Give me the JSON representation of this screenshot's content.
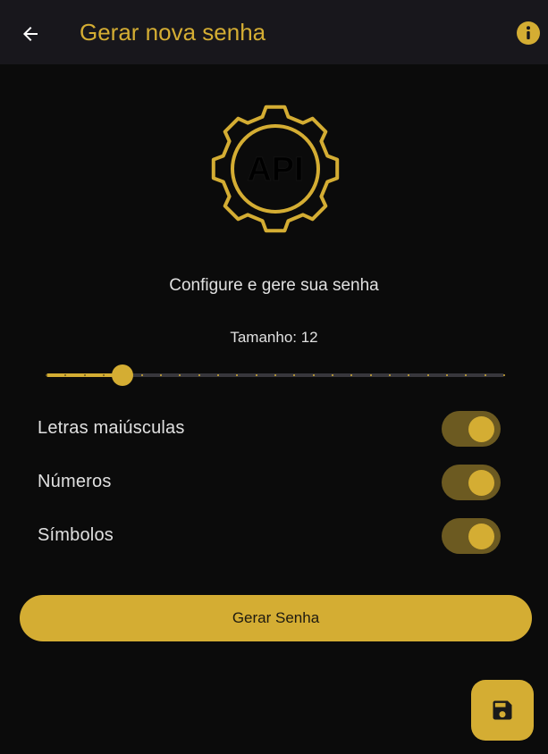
{
  "appbar": {
    "title": "Gerar nova senha",
    "back_icon": "arrow-left-icon",
    "info_icon": "info-icon"
  },
  "logo": {
    "icon": "gear-api-icon",
    "text": "API"
  },
  "subtitle": "Configure e gere sua senha",
  "length": {
    "label": "Tamanho: 12",
    "value": 12,
    "min": 8,
    "max": 32
  },
  "options": [
    {
      "label": "Letras maiúsculas",
      "enabled": true
    },
    {
      "label": "Números",
      "enabled": true
    },
    {
      "label": "Símbolos",
      "enabled": true
    }
  ],
  "generate_button": {
    "label": "Gerar Senha"
  },
  "fab": {
    "icon": "save-icon"
  },
  "colors": {
    "background": "#0b0b0b",
    "appbar": "#18171c",
    "accent": "#d4ad33",
    "switch_track": "#6c5a21",
    "text": "#e0e0e0"
  }
}
